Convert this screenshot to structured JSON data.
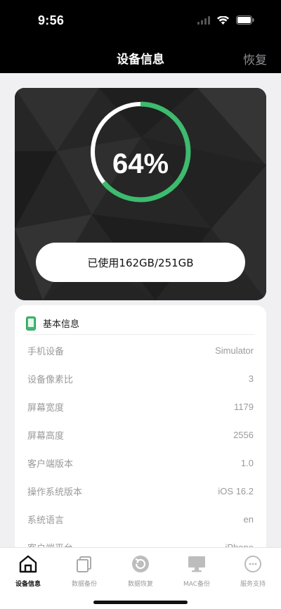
{
  "status_bar": {
    "time": "9:56",
    "icons": [
      "signal-icon",
      "wifi-icon",
      "battery-icon"
    ]
  },
  "nav": {
    "title": "设备信息",
    "right_action": "恢复"
  },
  "storage": {
    "percent_label": "64%",
    "used_fraction": 0.64,
    "usage_text": "已使用162GB/251GB",
    "accent": "#3dbb6e"
  },
  "basic_info": {
    "title": "基本信息",
    "rows": [
      {
        "key": "手机设备",
        "value": "Simulator"
      },
      {
        "key": "设备像素比",
        "value": "3"
      },
      {
        "key": "屏幕宽度",
        "value": "1179"
      },
      {
        "key": "屏幕高度",
        "value": "2556"
      },
      {
        "key": "客户端版本",
        "value": "1.0"
      },
      {
        "key": "操作系统版本",
        "value": "iOS 16.2"
      },
      {
        "key": "系统语言",
        "value": "en"
      },
      {
        "key": "客户端平台",
        "value": "iPhone"
      }
    ]
  },
  "tabs": [
    {
      "label": "设备信息",
      "icon": "home-icon",
      "active": true
    },
    {
      "label": "数据备份",
      "icon": "copy-icon",
      "active": false
    },
    {
      "label": "数据恢复",
      "icon": "restore-icon",
      "active": false
    },
    {
      "label": "MAC备份",
      "icon": "monitor-icon",
      "active": false
    },
    {
      "label": "服务支持",
      "icon": "support-icon",
      "active": false
    }
  ]
}
